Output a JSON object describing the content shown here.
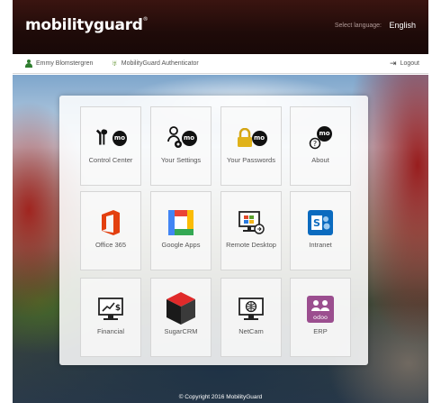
{
  "header": {
    "logo_text": "mobilityguard",
    "logo_reg": "®",
    "language_label": "Select language:",
    "language_value": "English"
  },
  "userbar": {
    "user_name": "Emmy Blomstergren",
    "app_name": "MobilityGuard Authenticator",
    "logout_label": "Logout"
  },
  "tiles": [
    {
      "label": "Control Center",
      "icon": "control-center-icon"
    },
    {
      "label": "Your Settings",
      "icon": "settings-icon"
    },
    {
      "label": "Your Passwords",
      "icon": "passwords-icon"
    },
    {
      "label": "About",
      "icon": "about-icon"
    },
    {
      "label": "Office 365",
      "icon": "office365-icon"
    },
    {
      "label": "Google Apps",
      "icon": "google-apps-icon"
    },
    {
      "label": "Remote Desktop",
      "icon": "remote-desktop-icon"
    },
    {
      "label": "Intranet",
      "icon": "sharepoint-icon"
    },
    {
      "label": "Financial",
      "icon": "financial-icon"
    },
    {
      "label": "SugarCRM",
      "icon": "sugarcrm-icon"
    },
    {
      "label": "NetCam",
      "icon": "netcam-icon"
    },
    {
      "label": "ERP",
      "icon": "odoo-icon"
    }
  ],
  "icon_text": {
    "mo": "mo",
    "sharepoint": "S",
    "odoo": "odoo",
    "financial": "$"
  },
  "footer": {
    "copyright": "© Copyright 2016 MobilityGuard"
  },
  "colors": {
    "office": "#e3400f",
    "sharepoint": "#0b6bbf",
    "odoo": "#9b4e8f",
    "google_blue": "#4285f4",
    "google_red": "#ea4335",
    "google_yellow": "#fbbc05",
    "google_green": "#34a853"
  }
}
